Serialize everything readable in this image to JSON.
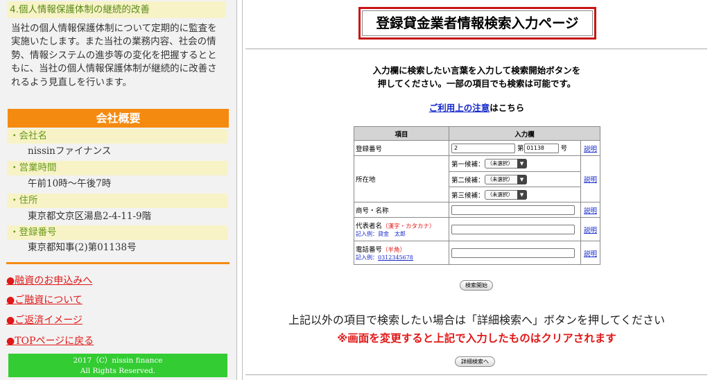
{
  "left": {
    "privacy": {
      "heading": "4.個人情報保護体制の継続的改善",
      "body_lines": [
        "当社の個人情報保護体制について定期的に監査を",
        "実施いたします。また当社の業務内容、社会の情",
        "勢、情報システムの進歩等の変化を把握するとと",
        "もに、当社の個人情報保護体制が継続的に改善さ",
        "れるよう見直しを行います。"
      ]
    },
    "company": {
      "heading": "会社概要",
      "items": [
        {
          "label": "・会社名",
          "value": "nissinファイナンス"
        },
        {
          "label": "・営業時間",
          "value": "午前10時〜午後7時"
        },
        {
          "label": "・住所",
          "value": "東京都文京区湯島2-4-11-9階"
        },
        {
          "label": "・登録番号",
          "value": "東京都知事(2)第01138号"
        }
      ]
    },
    "menu": [
      "●融資のお申込みへ",
      "●ご融資について",
      "●ご返済イメージ",
      "●TOPページに戻る"
    ],
    "footer": {
      "line1": "2017（C）nissin finance",
      "line2": "All Rights Reserved."
    }
  },
  "right": {
    "title": "登録貸金業者情報検索入力ページ",
    "instruction_line1": "入力欄に検索したい言葉を入力して検索開始ボタンを",
    "instruction_line2": "押してください。一部の項目でも検索は可能です。",
    "notice": {
      "link": "ご利用上の注意",
      "suffix": "はこちら"
    },
    "table": {
      "header_item": "項目",
      "header_input": "入力欄",
      "explain_label": "説明",
      "reg_number": {
        "label": "登録番号",
        "value1": "2",
        "mid": "第",
        "value2": "01138",
        "suffix": "号"
      },
      "location": {
        "label": "所在地",
        "candidates": [
          {
            "label": "第一候補：",
            "selected": "（未選択）"
          },
          {
            "label": "第二候補：",
            "selected": "（未選択）"
          },
          {
            "label": "第三候補：",
            "selected": "（未選択）"
          }
        ]
      },
      "trade_name": {
        "label": "商号・名称",
        "value": ""
      },
      "rep_name": {
        "label": "代表者名",
        "note": "（漢字・カタカナ）",
        "example": "記入例：貸金　太郎",
        "value": ""
      },
      "phone": {
        "label": "電話番号",
        "note": "（半角）",
        "example_prefix": "記入例：",
        "example_value": "0312345678",
        "value": ""
      }
    },
    "search_button": "検索開始",
    "detail_text": "上記以外の項目で検索したい場合は「詳細検索へ」ボタンを押してください",
    "warning_text": "※画面を変更すると上記で入力したものはクリアされます",
    "detail_button": "詳細検索へ"
  }
}
